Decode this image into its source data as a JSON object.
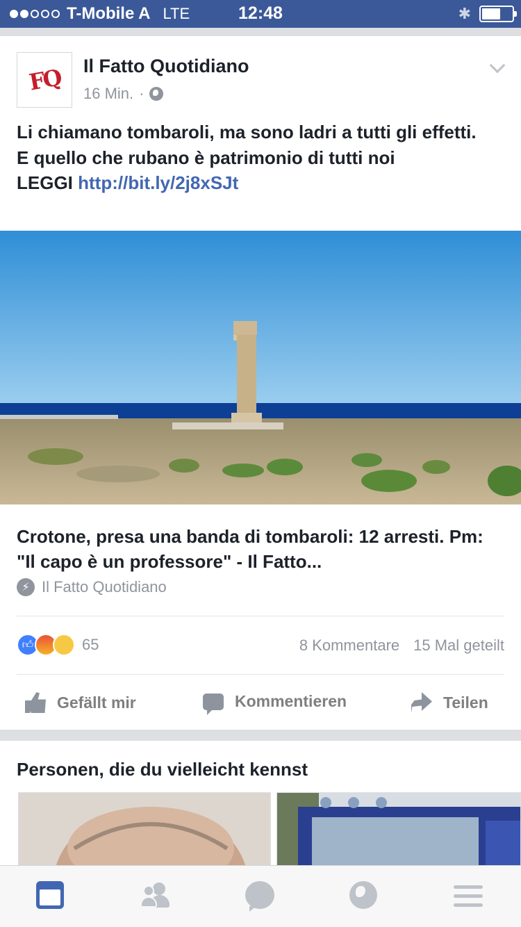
{
  "status_bar": {
    "carrier": "T-Mobile A",
    "network": "LTE",
    "time": "12:48",
    "signal_bars": 2,
    "signal_total": 5,
    "battery_level": 0.55
  },
  "post": {
    "page_name": "Il Fatto Quotidiano",
    "logo_text": "FQ",
    "time": "16 Min.",
    "separator": "·",
    "text_lines": [
      "Li chiamano tombaroli, ma sono ladri a tutti gli effetti.",
      "E quello che rubano è patrimonio di tutti noi"
    ],
    "leggi_label": "LEGGI",
    "link": "http://bit.ly/2j8xSJt",
    "link_title": "Crotone, presa una banda di tombaroli: 12 arresti. Pm: \"Il capo è un professore\" - Il Fatto...",
    "link_source": "Il Fatto Quotidiano",
    "reaction_count": "65",
    "comments": "8 Kommentare",
    "shares": "15 Mal geteilt",
    "actions": {
      "like": "Gefällt mir",
      "comment": "Kommentieren",
      "share": "Teilen"
    }
  },
  "pymk": {
    "title": "Personen, die du vielleicht kennst"
  },
  "colors": {
    "brand": "#3b5998",
    "link": "#4267b2",
    "muted": "#90949c"
  },
  "tabs": [
    "news-feed-icon",
    "friends-icon",
    "messenger-icon",
    "notifications-globe-icon",
    "menu-icon"
  ]
}
